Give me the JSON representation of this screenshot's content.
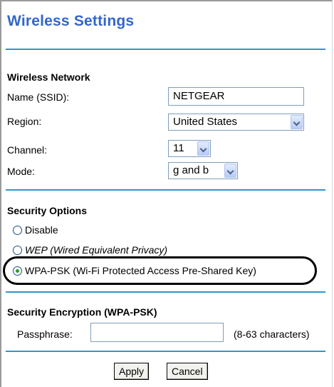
{
  "page": {
    "title": "Wireless Settings"
  },
  "wireless_network": {
    "section_label": "Wireless Network",
    "ssid": {
      "label": "Name (SSID):",
      "value": "NETGEAR"
    },
    "region": {
      "label": "Region:",
      "selected": "United States"
    },
    "channel": {
      "label": "Channel:",
      "selected": "11"
    },
    "mode": {
      "label": "Mode:",
      "selected": "g and b"
    }
  },
  "security_options": {
    "section_label": "Security Options",
    "options": [
      {
        "label": "Disable",
        "checked": false
      },
      {
        "label": "WEP (Wired Equivalent Privacy)",
        "checked": false
      },
      {
        "label": "WPA-PSK (Wi-Fi Protected Access Pre-Shared Key)",
        "checked": true
      }
    ]
  },
  "security_encryption": {
    "section_label": "Security Encryption (WPA-PSK)",
    "passphrase": {
      "label": "Passphrase:",
      "value": "",
      "hint": "(8-63 characters)"
    }
  },
  "buttons": {
    "apply": "Apply",
    "cancel": "Cancel"
  },
  "colors": {
    "title": "#3366cc",
    "divider": "#2f97c9",
    "checked_radio": "#21a121"
  },
  "icons": {
    "dropdown": "chevron-down-icon",
    "radio": "radio-icon"
  }
}
